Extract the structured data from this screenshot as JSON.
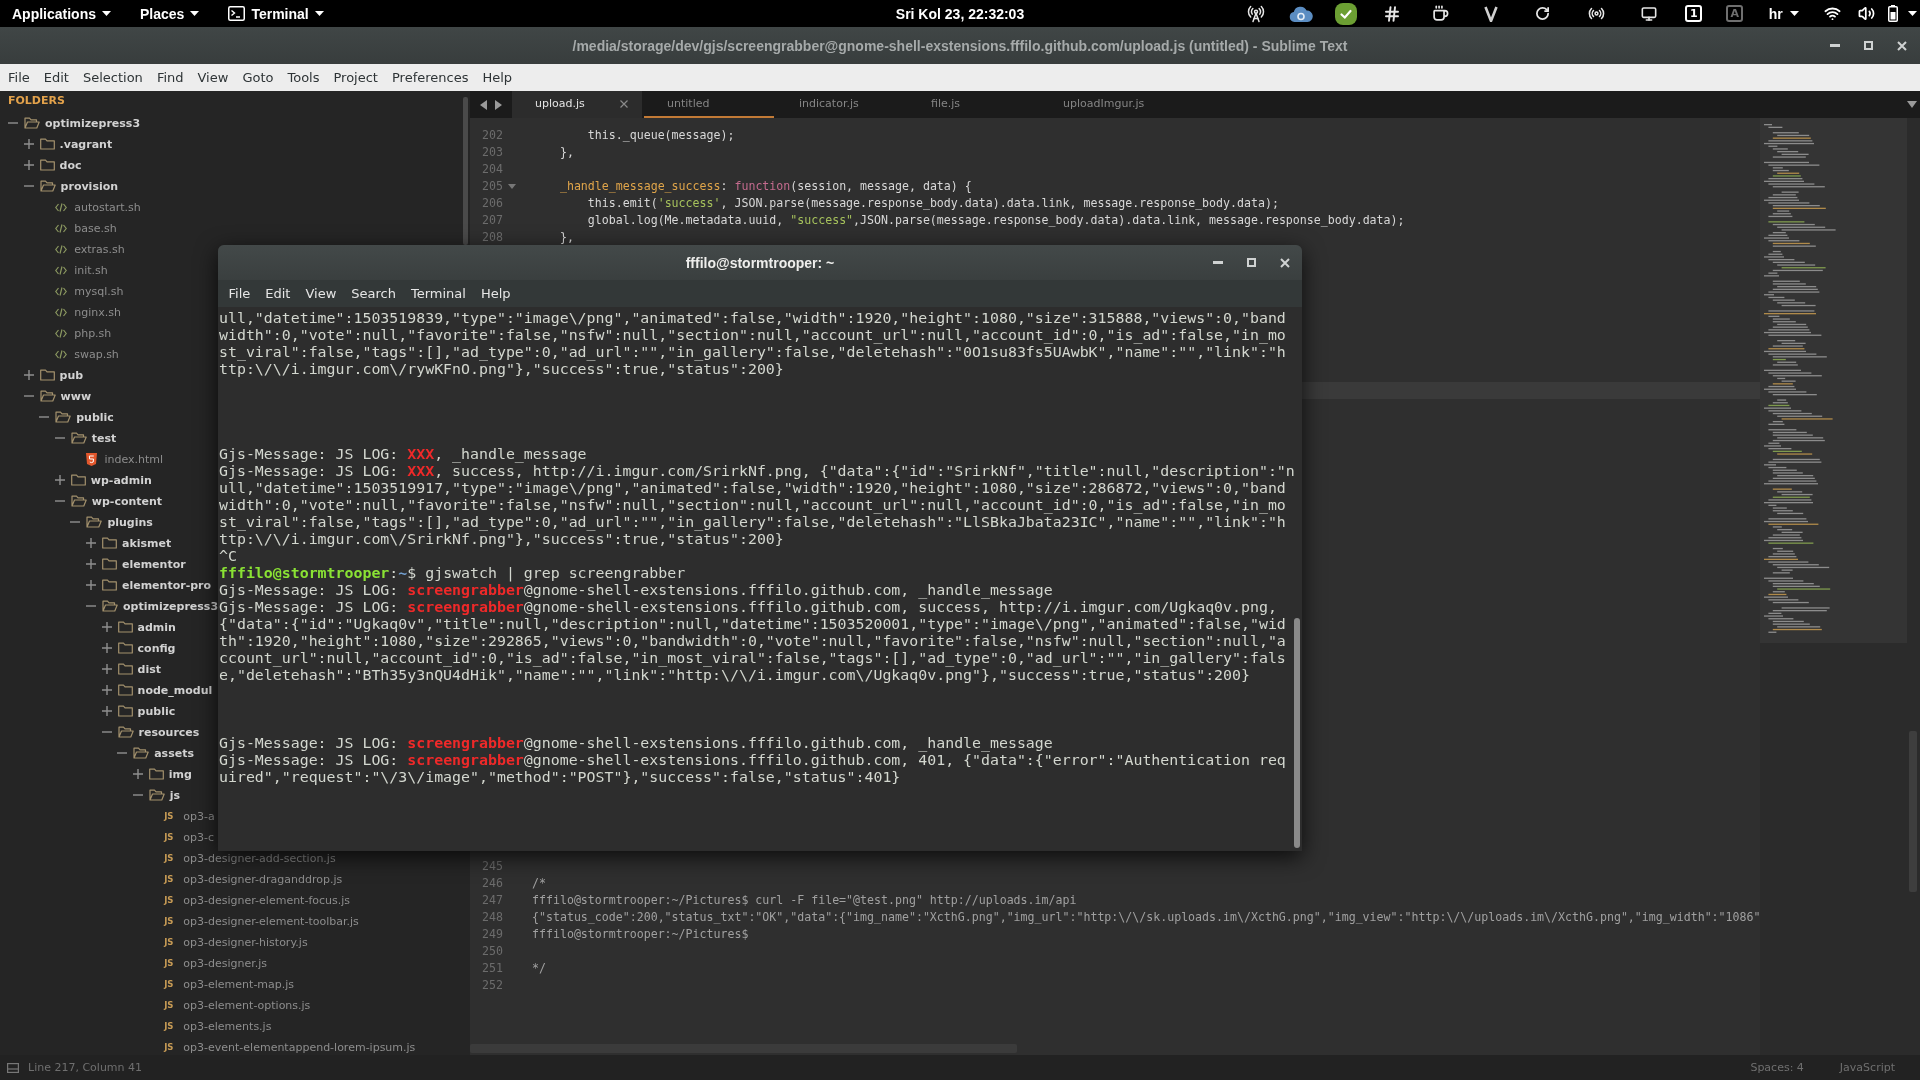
{
  "top_panel": {
    "menus": [
      {
        "label": "Applications",
        "kind": "menu"
      },
      {
        "label": "Places",
        "kind": "menu"
      },
      {
        "label": "Terminal",
        "kind": "app"
      }
    ],
    "clock": "Sri Kol 23, 22:32:03",
    "indicators": [
      {
        "text": "1",
        "active": true
      },
      {
        "text": "A",
        "active": false
      }
    ],
    "keyboard_layout": "hr"
  },
  "editor_window": {
    "title": "/media/storage/dev/gjs/screengrabber@gnome-shell-exstensions.fffilo.github.com/upload.js (untitled) - Sublime Text",
    "menu": [
      "File",
      "Edit",
      "Selection",
      "Find",
      "View",
      "Goto",
      "Tools",
      "Project",
      "Preferences",
      "Help"
    ],
    "sidebar": {
      "header": "FOLDERS",
      "tree": [
        {
          "name": "optimizepress3",
          "kind": "folder",
          "expanded": true,
          "children": [
            {
              "name": ".vagrant",
              "kind": "folder",
              "expanded": false
            },
            {
              "name": "doc",
              "kind": "folder",
              "expanded": false
            },
            {
              "name": "provision",
              "kind": "folder",
              "expanded": true,
              "children": [
                {
                  "name": "autostart.sh",
                  "kind": "script"
                },
                {
                  "name": "base.sh",
                  "kind": "script"
                },
                {
                  "name": "extras.sh",
                  "kind": "script"
                },
                {
                  "name": "init.sh",
                  "kind": "script"
                },
                {
                  "name": "mysql.sh",
                  "kind": "script"
                },
                {
                  "name": "nginx.sh",
                  "kind": "script"
                },
                {
                  "name": "php.sh",
                  "kind": "script"
                },
                {
                  "name": "swap.sh",
                  "kind": "script"
                }
              ]
            },
            {
              "name": "pub",
              "kind": "folder",
              "expanded": false
            },
            {
              "name": "www",
              "kind": "folder",
              "expanded": true,
              "children": [
                {
                  "name": "public",
                  "kind": "folder",
                  "expanded": true,
                  "children": [
                    {
                      "name": "test",
                      "kind": "folder",
                      "expanded": true,
                      "children": [
                        {
                          "name": "index.html",
                          "kind": "html"
                        }
                      ]
                    },
                    {
                      "name": "wp-admin",
                      "kind": "folder",
                      "expanded": false
                    },
                    {
                      "name": "wp-content",
                      "kind": "folder",
                      "expanded": true,
                      "children": [
                        {
                          "name": "plugins",
                          "kind": "folder",
                          "expanded": true,
                          "children": [
                            {
                              "name": "akismet",
                              "kind": "folder",
                              "expanded": false
                            },
                            {
                              "name": "elementor",
                              "kind": "folder",
                              "expanded": false
                            },
                            {
                              "name": "elementor-pro",
                              "kind": "folder",
                              "expanded": false
                            },
                            {
                              "name": "optimizepress3",
                              "kind": "folder",
                              "expanded": true,
                              "children": [
                                {
                                  "name": "admin",
                                  "kind": "folder",
                                  "expanded": false
                                },
                                {
                                  "name": "config",
                                  "kind": "folder",
                                  "expanded": false
                                },
                                {
                                  "name": "dist",
                                  "kind": "folder",
                                  "expanded": false
                                },
                                {
                                  "name": "node_modul",
                                  "kind": "folder",
                                  "expanded": false
                                },
                                {
                                  "name": "public",
                                  "kind": "folder",
                                  "expanded": false
                                },
                                {
                                  "name": "resources",
                                  "kind": "folder",
                                  "expanded": true,
                                  "children": [
                                    {
                                      "name": "assets",
                                      "kind": "folder",
                                      "expanded": true,
                                      "children": [
                                        {
                                          "name": "img",
                                          "kind": "folder",
                                          "expanded": false
                                        },
                                        {
                                          "name": "js",
                                          "kind": "folder",
                                          "expanded": true,
                                          "children": [
                                            {
                                              "name": "op3-a",
                                              "kind": "js",
                                              "icon_label": "JS"
                                            },
                                            {
                                              "name": "op3-c",
                                              "kind": "js",
                                              "icon_label": "JS"
                                            },
                                            {
                                              "name": "op3-designer-add-section.js",
                                              "kind": "js",
                                              "icon_label": "JS"
                                            },
                                            {
                                              "name": "op3-designer-draganddrop.js",
                                              "kind": "js",
                                              "icon_label": "JS"
                                            },
                                            {
                                              "name": "op3-designer-element-focus.js",
                                              "kind": "js",
                                              "icon_label": "JS"
                                            },
                                            {
                                              "name": "op3-designer-element-toolbar.js",
                                              "kind": "js",
                                              "icon_label": "JS"
                                            },
                                            {
                                              "name": "op3-designer-history.js",
                                              "kind": "js",
                                              "icon_label": "JS"
                                            },
                                            {
                                              "name": "op3-designer.js",
                                              "kind": "js",
                                              "icon_label": "JS"
                                            },
                                            {
                                              "name": "op3-element-map.js",
                                              "kind": "js",
                                              "icon_label": "JS"
                                            },
                                            {
                                              "name": "op3-element-options.js",
                                              "kind": "js",
                                              "icon_label": "JS"
                                            },
                                            {
                                              "name": "op3-elements.js",
                                              "kind": "js",
                                              "icon_label": "JS"
                                            },
                                            {
                                              "name": "op3-event-elementappend-lorem-ipsum.js",
                                              "kind": "js",
                                              "icon_label": "JS"
                                            }
                                          ]
                                        }
                                      ]
                                    }
                                  ]
                                }
                              ]
                            }
                          ]
                        }
                      ]
                    }
                  ]
                }
              ]
            }
          ]
        }
      ]
    },
    "tabs": [
      {
        "label": "upload.js",
        "selected": true,
        "accent": false
      },
      {
        "label": "untitled",
        "selected": false,
        "accent": true
      },
      {
        "label": "indicator.js",
        "selected": false,
        "accent": false
      },
      {
        "label": "file.js",
        "selected": false,
        "accent": false
      },
      {
        "label": "uploadImgur.js",
        "selected": false,
        "accent": false
      }
    ],
    "editor": {
      "lines_above": [
        {
          "number": "202",
          "segments": [
            {
              "text": "        this._queue(message);",
              "kind": "plain"
            }
          ]
        },
        {
          "number": "203",
          "segments": [
            {
              "text": "    },",
              "kind": "plain"
            }
          ]
        },
        {
          "number": "204"
        },
        {
          "number": "205",
          "foldable": true,
          "segments": [
            {
              "text": "    _handle_message_success",
              "kind": "property"
            },
            {
              "text": ": ",
              "kind": "plain"
            },
            {
              "text": "function",
              "kind": "keyword"
            },
            {
              "text": "(session, message, data) {",
              "kind": "plain"
            }
          ]
        },
        {
          "number": "206",
          "segments": [
            {
              "text": "        this.emit(",
              "kind": "plain"
            },
            {
              "text": "'success'",
              "kind": "string"
            },
            {
              "text": ", JSON.parse(message.response_body.data).data.link, message.response_body.data);",
              "kind": "plain"
            }
          ]
        },
        {
          "number": "207",
          "segments": [
            {
              "text": "        global.log(Me.metadata.uuid, ",
              "kind": "plain"
            },
            {
              "text": "\"success\"",
              "kind": "string"
            },
            {
              "text": ",JSON.parse(message.response_body.data).data.link, message.response_body.data);",
              "kind": "plain"
            }
          ]
        },
        {
          "number": "208",
          "segments": [
            {
              "text": "    },",
              "kind": "plain"
            }
          ]
        }
      ],
      "current_line_highlight": true,
      "lines_below": [
        {
          "number": "245"
        },
        {
          "number": "246",
          "segments": [
            {
              "text": "/*",
              "kind": "comment"
            }
          ]
        },
        {
          "number": "247",
          "segments": [
            {
              "text": "fffilo@stormtrooper:~/Pictures$ curl -F file=\"@test.png\" http://uploads.im/api",
              "kind": "comment"
            }
          ]
        },
        {
          "number": "248",
          "segments": [
            {
              "text": "{\"status_code\":200,\"status_txt\":\"OK\",\"data\":{\"img_name\":\"XcthG.png\",\"img_url\":\"http:\\/\\/sk.uploads.im\\/XcthG.png\",\"img_view\":\"http:\\/\\/uploads.im\\/XcthG.png\",\"img_width\":\"1086\"",
              "kind": "comment"
            }
          ]
        },
        {
          "number": "249",
          "segments": [
            {
              "text": "fffilo@stormtrooper:~/Pictures$",
              "kind": "comment"
            }
          ]
        },
        {
          "number": "250"
        },
        {
          "number": "251",
          "segments": [
            {
              "text": "*/",
              "kind": "comment"
            }
          ]
        },
        {
          "number": "252"
        }
      ]
    },
    "status_bar": {
      "position": "Line 217, Column 41",
      "indentation": "Spaces: 4",
      "syntax": "JavaScript"
    }
  },
  "terminal_window": {
    "title": "fffilo@stormtrooper: ~",
    "menu": [
      "File",
      "Edit",
      "View",
      "Search",
      "Terminal",
      "Help"
    ],
    "lines": [
      {
        "kind": "output",
        "segments": [
          {
            "text": "ull,\"datetime\":1503519839,\"type\":\"image\\/png\",\"animated\":false,\"width\":1920,\"height\":1080,\"size\":315888,\"views\":0,\"band",
            "kind": "plain"
          }
        ]
      },
      {
        "kind": "output",
        "segments": [
          {
            "text": "width\":0,\"vote\":null,\"favorite\":false,\"nsfw\":null,\"section\":null,\"account_url\":null,\"account_id\":0,\"is_ad\":false,\"in_mo",
            "kind": "plain"
          }
        ]
      },
      {
        "kind": "output",
        "segments": [
          {
            "text": "st_viral\":false,\"tags\":[],\"ad_type\":0,\"ad_url\":\"\",\"in_gallery\":false,\"deletehash\":\"0O1su83fs5UAwbK\",\"name\":\"\",\"link\":\"h",
            "kind": "plain"
          }
        ]
      },
      {
        "kind": "output",
        "segments": [
          {
            "text": "ttp:\\/\\/i.imgur.com\\/rywKFnO.png\"},\"success\":true,\"status\":200}",
            "kind": "plain"
          }
        ]
      },
      {
        "kind": "blank"
      },
      {
        "kind": "blank"
      },
      {
        "kind": "blank"
      },
      {
        "kind": "blank"
      },
      {
        "kind": "output",
        "segments": [
          {
            "text": "Gjs-Message: JS LOG: ",
            "kind": "plain"
          },
          {
            "text": "XXX",
            "kind": "match"
          },
          {
            "text": ", _handle_message",
            "kind": "plain"
          }
        ]
      },
      {
        "kind": "output",
        "segments": [
          {
            "text": "Gjs-Message: JS LOG: ",
            "kind": "plain"
          },
          {
            "text": "XXX",
            "kind": "match"
          },
          {
            "text": ", success, http://i.imgur.com/SrirkNf.png, {\"data\":{\"id\":\"SrirkNf\",\"title\":null,\"description\":\"n",
            "kind": "plain"
          }
        ]
      },
      {
        "kind": "output",
        "segments": [
          {
            "text": "ull,\"datetime\":1503519917,\"type\":\"image\\/png\",\"animated\":false,\"width\":1920,\"height\":1080,\"size\":286872,\"views\":0,\"band",
            "kind": "plain"
          }
        ]
      },
      {
        "kind": "output",
        "segments": [
          {
            "text": "width\":0,\"vote\":null,\"favorite\":false,\"nsfw\":null,\"section\":null,\"account_url\":null,\"account_id\":0,\"is_ad\":false,\"in_mo",
            "kind": "plain"
          }
        ]
      },
      {
        "kind": "output",
        "segments": [
          {
            "text": "st_viral\":false,\"tags\":[],\"ad_type\":0,\"ad_url\":\"\",\"in_gallery\":false,\"deletehash\":\"LlSBkaJbata23IC\",\"name\":\"\",\"link\":\"h",
            "kind": "plain"
          }
        ]
      },
      {
        "kind": "output",
        "segments": [
          {
            "text": "ttp:\\/\\/i.imgur.com\\/SrirkNf.png\"},\"success\":true,\"status\":200}",
            "kind": "plain"
          }
        ]
      },
      {
        "kind": "output",
        "segments": [
          {
            "text": "^C",
            "kind": "plain"
          }
        ]
      },
      {
        "kind": "output",
        "segments": [
          {
            "text": "fffilo@stormtrooper",
            "kind": "user"
          },
          {
            "text": ":",
            "kind": "plain"
          },
          {
            "text": "~",
            "kind": "path"
          },
          {
            "text": "$ gjswatch | grep screengrabber",
            "kind": "plain"
          }
        ]
      },
      {
        "kind": "output",
        "segments": [
          {
            "text": "Gjs-Message: JS LOG: ",
            "kind": "plain"
          },
          {
            "text": "screengrabber",
            "kind": "match"
          },
          {
            "text": "@gnome-shell-exstensions.fffilo.github.com, _handle_message",
            "kind": "plain"
          }
        ]
      },
      {
        "kind": "output",
        "segments": [
          {
            "text": "Gjs-Message: JS LOG: ",
            "kind": "plain"
          },
          {
            "text": "screengrabber",
            "kind": "match"
          },
          {
            "text": "@gnome-shell-exstensions.fffilo.github.com, success, http://i.imgur.com/Ugkaq0v.png,",
            "kind": "plain"
          }
        ]
      },
      {
        "kind": "output",
        "segments": [
          {
            "text": "{\"data\":{\"id\":\"Ugkaq0v\",\"title\":null,\"description\":null,\"datetime\":1503520001,\"type\":\"image\\/png\",\"animated\":false,\"wid",
            "kind": "plain"
          }
        ]
      },
      {
        "kind": "output",
        "segments": [
          {
            "text": "th\":1920,\"height\":1080,\"size\":292865,\"views\":0,\"bandwidth\":0,\"vote\":null,\"favorite\":false,\"nsfw\":null,\"section\":null,\"a",
            "kind": "plain"
          }
        ]
      },
      {
        "kind": "output",
        "segments": [
          {
            "text": "ccount_url\":null,\"account_id\":0,\"is_ad\":false,\"in_most_viral\":false,\"tags\":[],\"ad_type\":0,\"ad_url\":\"\",\"in_gallery\":fals",
            "kind": "plain"
          }
        ]
      },
      {
        "kind": "output",
        "segments": [
          {
            "text": "e,\"deletehash\":\"BTh35y3nQU4dHik\",\"name\":\"\",\"link\":\"http:\\/\\/i.imgur.com\\/Ugkaq0v.png\"},\"success\":true,\"status\":200}",
            "kind": "plain"
          }
        ]
      },
      {
        "kind": "blank"
      },
      {
        "kind": "blank"
      },
      {
        "kind": "blank"
      },
      {
        "kind": "output",
        "segments": [
          {
            "text": "Gjs-Message: JS LOG: ",
            "kind": "plain"
          },
          {
            "text": "screengrabber",
            "kind": "match"
          },
          {
            "text": "@gnome-shell-exstensions.fffilo.github.com, _handle_message",
            "kind": "plain"
          }
        ]
      },
      {
        "kind": "output",
        "segments": [
          {
            "text": "Gjs-Message: JS LOG: ",
            "kind": "plain"
          },
          {
            "text": "screengrabber",
            "kind": "match"
          },
          {
            "text": "@gnome-shell-exstensions.fffilo.github.com, 401, {\"data\":{\"error\":\"Authentication req",
            "kind": "plain"
          }
        ]
      },
      {
        "kind": "output",
        "segments": [
          {
            "text": "uired\",\"request\":\"\\/3\\/image\",\"method\":\"POST\"},\"success\":false,\"status\":401}",
            "kind": "plain"
          }
        ]
      }
    ]
  }
}
